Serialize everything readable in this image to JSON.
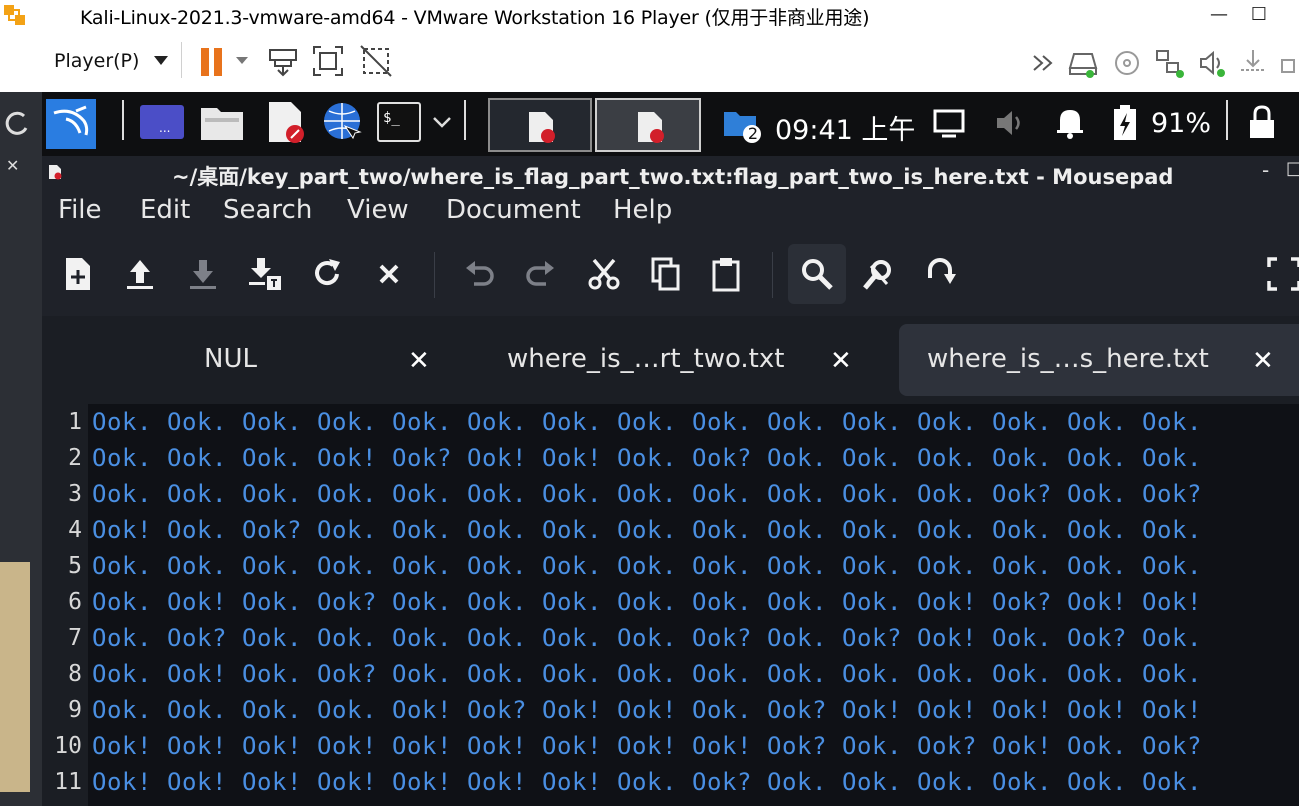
{
  "host": {
    "title": "Kali-Linux-2021.3-vmware-amd64 - VMware Workstation 16 Player (仅用于非商业用途)",
    "player_menu": "Player(P)",
    "controls": {
      "minimize": "—",
      "maximize": "☐"
    }
  },
  "panel": {
    "workspace_badge": "2",
    "clock": "09:41 上午",
    "battery": "91%"
  },
  "window": {
    "title": "~/桌面/key_part_two/where_is_flag_part_two.txt:flag_part_two_is_here.txt - Mousepad",
    "controls": {
      "minimize": "-",
      "maximize": "□"
    }
  },
  "menubar": [
    "File",
    "Edit",
    "Search",
    "View",
    "Document",
    "Help"
  ],
  "tabs": [
    {
      "label": "NUL",
      "close": "✕"
    },
    {
      "label": "where_is_…rt_two.txt",
      "close": "✕"
    },
    {
      "label": "where_is_…s_here.txt",
      "close": "✕"
    }
  ],
  "editor": {
    "line_numbers": [
      "1",
      "2",
      "3",
      "4",
      "5",
      "6",
      "7",
      "8",
      "9",
      "10",
      "11"
    ],
    "lines": [
      "Ook. Ook. Ook. Ook. Ook. Ook. Ook. Ook. Ook. Ook. Ook. Ook. Ook. Ook. Ook.",
      "Ook. Ook. Ook. Ook! Ook? Ook! Ook! Ook. Ook? Ook. Ook. Ook. Ook. Ook. Ook.",
      "Ook. Ook. Ook. Ook. Ook. Ook. Ook. Ook. Ook. Ook. Ook. Ook. Ook? Ook. Ook?",
      "Ook! Ook. Ook? Ook. Ook. Ook. Ook. Ook. Ook. Ook. Ook. Ook. Ook. Ook. Ook.",
      "Ook. Ook. Ook. Ook. Ook. Ook. Ook. Ook. Ook. Ook. Ook. Ook. Ook. Ook. Ook.",
      "Ook. Ook! Ook. Ook? Ook. Ook. Ook. Ook. Ook. Ook. Ook. Ook! Ook? Ook! Ook!",
      "Ook. Ook? Ook. Ook. Ook. Ook. Ook. Ook. Ook? Ook. Ook? Ook! Ook. Ook? Ook.",
      "Ook. Ook! Ook. Ook? Ook. Ook. Ook. Ook. Ook. Ook. Ook. Ook. Ook. Ook. Ook.",
      "Ook. Ook. Ook. Ook. Ook! Ook? Ook! Ook! Ook. Ook? Ook! Ook! Ook! Ook! Ook!",
      "Ook! Ook! Ook! Ook! Ook! Ook! Ook! Ook! Ook! Ook? Ook. Ook? Ook! Ook. Ook?",
      "Ook! Ook! Ook! Ook! Ook! Ook! Ook! Ook. Ook? Ook. Ook. Ook. Ook. Ook. Ook."
    ]
  },
  "colors": {
    "editor_text": "#4a8fe2",
    "pause_orange": "#e8731c",
    "kali_blue": "#2a7de1"
  }
}
